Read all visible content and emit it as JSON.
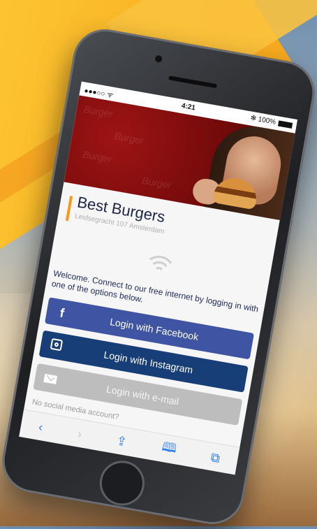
{
  "status": {
    "signal": "●●●○○ ᯤ",
    "time": "4:21",
    "battery": "✻ 100%"
  },
  "hero": {
    "doodles": [
      "Burger",
      "Burger",
      "Burger",
      "Burger"
    ]
  },
  "brand": {
    "title": "Best Burgers",
    "subtitle": "Leidsegracht 107 Amsterdam"
  },
  "welcome_text": "Welcome. Connect to our free internet by logging in with one of the options below.",
  "buttons": {
    "facebook": {
      "icon": "f",
      "label": "Login with Facebook"
    },
    "instagram": {
      "label": "Login with Instagram"
    },
    "email": {
      "label": "Login with e-mail"
    }
  },
  "no_social": "No social media account?",
  "toolbar": {
    "back": "‹",
    "forward": "›",
    "share": "⇪",
    "bookmarks": "🕮",
    "tabs": "⧉"
  },
  "colors": {
    "facebook": "#3f55a4",
    "instagram": "#173e76",
    "email": "#bdbdbd",
    "accent": "#f39a1f",
    "hero": "#8b0e0e"
  }
}
